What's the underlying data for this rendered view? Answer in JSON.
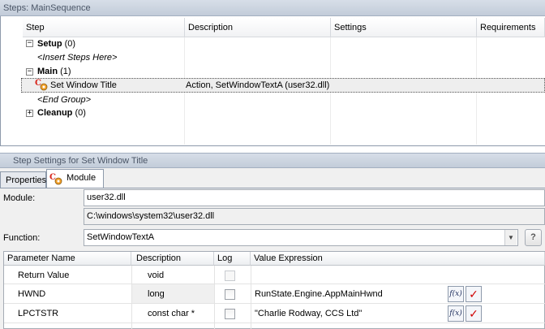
{
  "steps_panel": {
    "title": "Steps: MainSequence",
    "columns": [
      "Step",
      "Description",
      "Settings",
      "Requirements"
    ],
    "groups": {
      "setup": {
        "name": "Setup",
        "count": "(0)",
        "expander": "−",
        "placeholder": "<Insert Steps Here>"
      },
      "main": {
        "name": "Main",
        "count": "(1)",
        "expander": "−",
        "end_marker": "<End Group>"
      },
      "cleanup": {
        "name": "Cleanup",
        "count": "(0)",
        "expander": "+"
      }
    },
    "step": {
      "name": "Set Window Title",
      "description": "Action,  SetWindowTextA (user32.dll)",
      "icon": "action-step-icon"
    }
  },
  "settings_panel": {
    "title": "Step Settings for Set Window Title",
    "tabs": [
      "Properties",
      "Module"
    ],
    "active_tab": "Module",
    "module_label": "Module:",
    "module_value": "user32.dll",
    "module_path": "C:\\windows\\system32\\user32.dll",
    "function_label": "Function:",
    "function_value": "SetWindowTextA",
    "help_glyph": "?",
    "params": {
      "columns": [
        "Parameter Name",
        "Description",
        "Log",
        "Value Expression"
      ],
      "rows": [
        {
          "name": "Return Value",
          "description": "void",
          "value": ""
        },
        {
          "name": "HWND",
          "description": "long",
          "value": "RunState.Engine.AppMainHwnd",
          "fx": "f(x)",
          "check": "✓"
        },
        {
          "name": "LPCTSTR",
          "description": "const char *",
          "value": "\"Charlie Rodway, CCS Ltd\"",
          "fx": "f(x)",
          "check": "✓"
        }
      ]
    }
  },
  "colors": {
    "title_bar": "#c9d2de",
    "selection_row": "#eeeeee",
    "check_red": "#d00000",
    "icon_red": "#d8261c",
    "icon_orange": "#f2a12a"
  }
}
